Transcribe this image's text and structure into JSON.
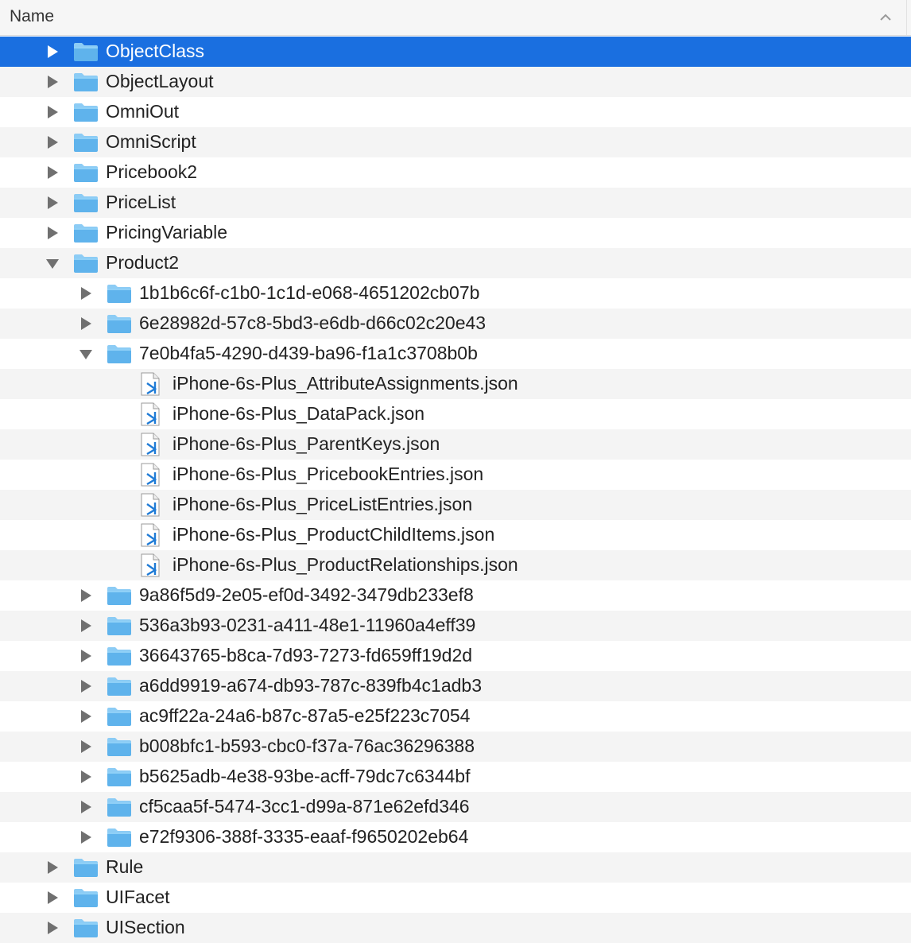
{
  "header": {
    "title": "Name",
    "sort_icon": "chevron-up-icon"
  },
  "colors": {
    "selection": "#1a6fe0",
    "folder": "#5fb3ec",
    "folder_tab": "#8cccf5",
    "file_accent": "#1f7bd6",
    "stripe": "#f4f4f4",
    "disclosure": "#707070"
  },
  "rows": [
    {
      "name": "ObjectClass",
      "type": "folder",
      "level": 0,
      "expanded": false,
      "selected": true
    },
    {
      "name": "ObjectLayout",
      "type": "folder",
      "level": 0,
      "expanded": false
    },
    {
      "name": "OmniOut",
      "type": "folder",
      "level": 0,
      "expanded": false
    },
    {
      "name": "OmniScript",
      "type": "folder",
      "level": 0,
      "expanded": false
    },
    {
      "name": "Pricebook2",
      "type": "folder",
      "level": 0,
      "expanded": false
    },
    {
      "name": "PriceList",
      "type": "folder",
      "level": 0,
      "expanded": false
    },
    {
      "name": "PricingVariable",
      "type": "folder",
      "level": 0,
      "expanded": false
    },
    {
      "name": "Product2",
      "type": "folder",
      "level": 0,
      "expanded": true
    },
    {
      "name": "1b1b6c6f-c1b0-1c1d-e068-4651202cb07b",
      "type": "folder",
      "level": 1,
      "expanded": false
    },
    {
      "name": "6e28982d-57c8-5bd3-e6db-d66c02c20e43",
      "type": "folder",
      "level": 1,
      "expanded": false
    },
    {
      "name": "7e0b4fa5-4290-d439-ba96-f1a1c3708b0b",
      "type": "folder",
      "level": 1,
      "expanded": true
    },
    {
      "name": "iPhone-6s-Plus_AttributeAssignments.json",
      "type": "file",
      "level": 2
    },
    {
      "name": "iPhone-6s-Plus_DataPack.json",
      "type": "file",
      "level": 2
    },
    {
      "name": "iPhone-6s-Plus_ParentKeys.json",
      "type": "file",
      "level": 2
    },
    {
      "name": "iPhone-6s-Plus_PricebookEntries.json",
      "type": "file",
      "level": 2
    },
    {
      "name": "iPhone-6s-Plus_PriceListEntries.json",
      "type": "file",
      "level": 2
    },
    {
      "name": "iPhone-6s-Plus_ProductChildItems.json",
      "type": "file",
      "level": 2
    },
    {
      "name": "iPhone-6s-Plus_ProductRelationships.json",
      "type": "file",
      "level": 2
    },
    {
      "name": "9a86f5d9-2e05-ef0d-3492-3479db233ef8",
      "type": "folder",
      "level": 1,
      "expanded": false
    },
    {
      "name": "536a3b93-0231-a411-48e1-11960a4eff39",
      "type": "folder",
      "level": 1,
      "expanded": false
    },
    {
      "name": "36643765-b8ca-7d93-7273-fd659ff19d2d",
      "type": "folder",
      "level": 1,
      "expanded": false
    },
    {
      "name": "a6dd9919-a674-db93-787c-839fb4c1adb3",
      "type": "folder",
      "level": 1,
      "expanded": false
    },
    {
      "name": "ac9ff22a-24a6-b87c-87a5-e25f223c7054",
      "type": "folder",
      "level": 1,
      "expanded": false
    },
    {
      "name": "b008bfc1-b593-cbc0-f37a-76ac36296388",
      "type": "folder",
      "level": 1,
      "expanded": false
    },
    {
      "name": "b5625adb-4e38-93be-acff-79dc7c6344bf",
      "type": "folder",
      "level": 1,
      "expanded": false
    },
    {
      "name": "cf5caa5f-5474-3cc1-d99a-871e62efd346",
      "type": "folder",
      "level": 1,
      "expanded": false
    },
    {
      "name": "e72f9306-388f-3335-eaaf-f9650202eb64",
      "type": "folder",
      "level": 1,
      "expanded": false
    },
    {
      "name": "Rule",
      "type": "folder",
      "level": 0,
      "expanded": false
    },
    {
      "name": "UIFacet",
      "type": "folder",
      "level": 0,
      "expanded": false
    },
    {
      "name": "UISection",
      "type": "folder",
      "level": 0,
      "expanded": false
    }
  ]
}
